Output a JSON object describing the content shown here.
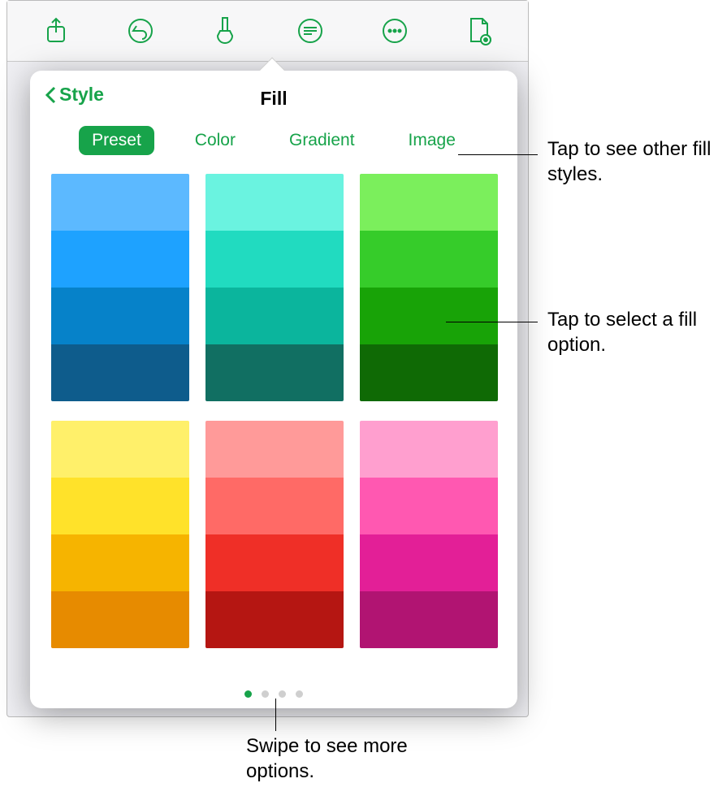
{
  "toolbar": {
    "icons": [
      "share-icon",
      "undo-icon",
      "format-brush-icon",
      "insert-icon",
      "more-icon",
      "document-settings-icon"
    ]
  },
  "popover": {
    "back_label": "Style",
    "title": "Fill",
    "tabs": [
      {
        "label": "Preset",
        "active": true
      },
      {
        "label": "Color",
        "active": false
      },
      {
        "label": "Gradient",
        "active": false
      },
      {
        "label": "Image",
        "active": false
      }
    ],
    "swatches": [
      {
        "name": "blue",
        "rows": [
          "#5cb9ff",
          "#1ea2ff",
          "#0682c9",
          "#0e5c8c"
        ]
      },
      {
        "name": "teal",
        "rows": [
          "#6af3e0",
          "#21dbc0",
          "#0bb59d",
          "#116f62"
        ]
      },
      {
        "name": "green",
        "rows": [
          "#7bef5c",
          "#36cc2a",
          "#18a307",
          "#0f6a05"
        ]
      },
      {
        "name": "yellow",
        "rows": [
          "#fff06a",
          "#ffe22a",
          "#f6b400",
          "#e78b00"
        ]
      },
      {
        "name": "red",
        "rows": [
          "#ff9a99",
          "#ff6a66",
          "#ef2f27",
          "#b51612"
        ]
      },
      {
        "name": "pink",
        "rows": [
          "#ff9fcf",
          "#ff58b1",
          "#e31f97",
          "#b11472"
        ]
      }
    ],
    "page_dots_total": 4,
    "page_dots_active_index": 0
  },
  "callouts": {
    "fill_styles": "Tap to see other fill styles.",
    "select_fill": "Tap to select a fill option.",
    "swipe_more": "Swipe to see more options."
  }
}
